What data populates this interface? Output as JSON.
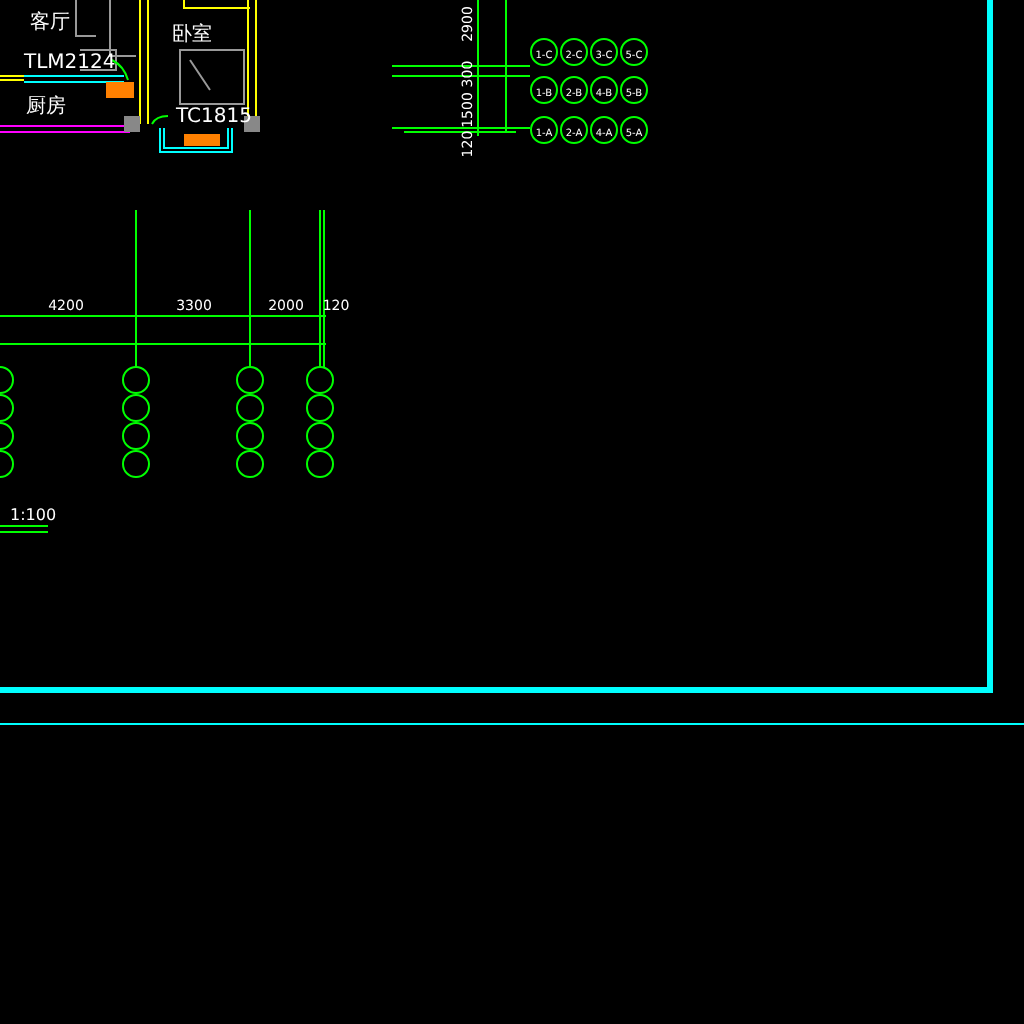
{
  "floor_plan": {
    "labels": [
      "客厅",
      "TLM2124",
      "厨房",
      "卧室",
      "TC1815"
    ]
  },
  "vertical_dimensions": [
    "2900",
    "300",
    "1500",
    "120"
  ],
  "axis_bubbles": [
    [
      "1-C",
      "2-C",
      "3-C",
      "5-C"
    ],
    [
      "1-B",
      "2-B",
      "4-B",
      "5-B"
    ],
    [
      "1-A",
      "2-A",
      "4-A",
      "5-A"
    ]
  ],
  "horizontal_dimensions": [
    "4200",
    "3300",
    "2000",
    "120"
  ],
  "scale": "1:100"
}
